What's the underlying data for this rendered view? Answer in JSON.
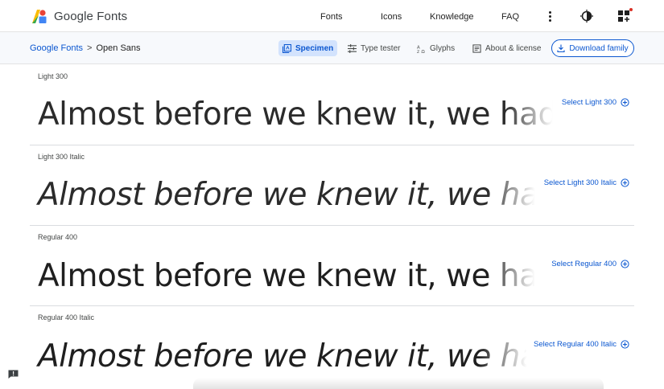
{
  "header": {
    "brand": "Google Fonts",
    "nav": [
      "Fonts",
      "Icons",
      "Knowledge",
      "FAQ"
    ],
    "icons": [
      "more-vert-icon",
      "theme-toggle-icon",
      "apps-icon"
    ],
    "notification_color": "#d93025"
  },
  "subbar": {
    "breadcrumb_root": "Google Fonts",
    "breadcrumb_sep": ">",
    "breadcrumb_current": "Open Sans",
    "tabs": [
      "Specimen",
      "Type tester",
      "Glyphs",
      "About & license"
    ],
    "active_tab": "Specimen",
    "download_label": "Download family"
  },
  "styles": [
    {
      "label": "Light 300",
      "sample": "Almost before we knew it, we had lef",
      "select": "Select Light 300"
    },
    {
      "label": "Light 300 Italic",
      "sample": "Almost before we knew it, we had left",
      "select": "Select Light 300 Italic"
    },
    {
      "label": "Regular 400",
      "sample": "Almost before we knew it, we had",
      "select": "Select Regular 400"
    },
    {
      "label": "Regular 400 Italic",
      "sample": "Almost before we knew it, we had le",
      "select": "Select Regular 400 Italic"
    }
  ],
  "colors": {
    "accent": "#0b57d0",
    "active_tab_bg": "#d3e3fd",
    "subbar_bg": "#f7f9fc"
  }
}
